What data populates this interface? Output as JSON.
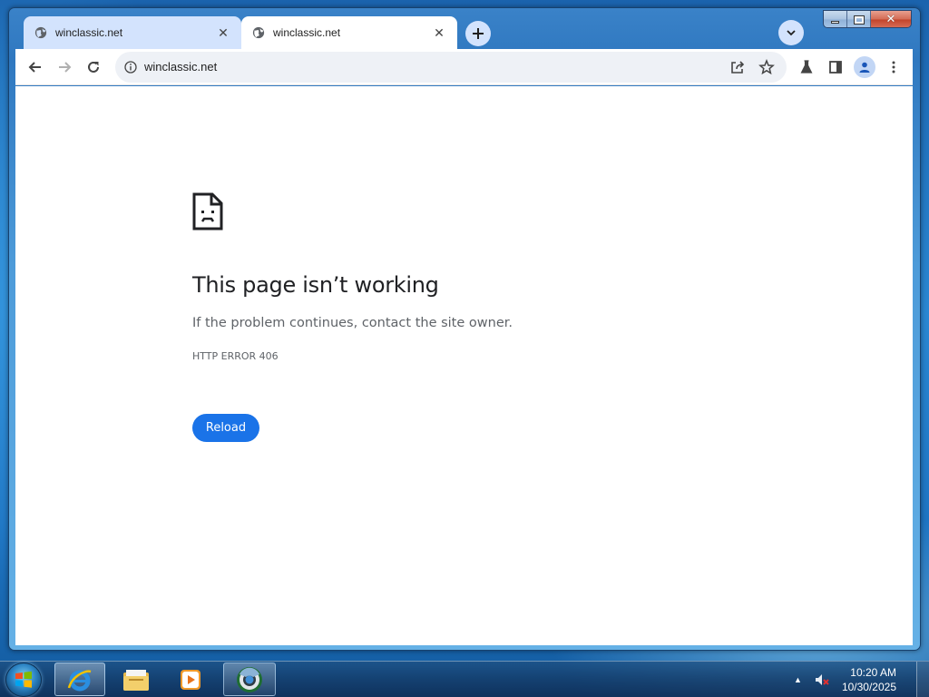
{
  "browser": {
    "tabs": [
      {
        "title": "winclassic.net",
        "active": false
      },
      {
        "title": "winclassic.net",
        "active": true
      }
    ],
    "url": "winclassic.net"
  },
  "error_page": {
    "title": "This page isn’t working",
    "description": "If the problem continues, contact the site owner.",
    "code": "HTTP ERROR 406",
    "reload_label": "Reload",
    "accent_color": "#1a73e8"
  },
  "taskbar": {
    "pinned": [
      "internet-explorer-icon",
      "file-explorer-icon",
      "media-player-icon",
      "chrome-icon"
    ],
    "clock": {
      "time": "10:20 AM",
      "date": "10/30/2025"
    }
  }
}
